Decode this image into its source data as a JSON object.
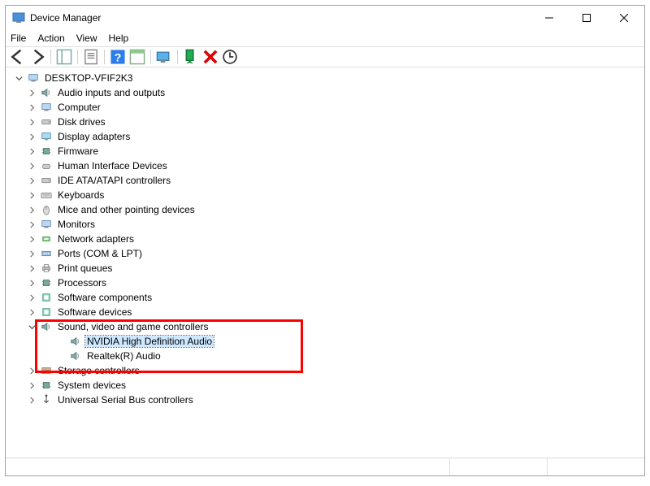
{
  "title": "Device Manager",
  "menu": {
    "file": "File",
    "action": "Action",
    "view": "View",
    "help": "Help"
  },
  "tree": {
    "root": "DESKTOP-VFIF2K3",
    "categories": [
      {
        "label": "Audio inputs and outputs"
      },
      {
        "label": "Computer"
      },
      {
        "label": "Disk drives"
      },
      {
        "label": "Display adapters"
      },
      {
        "label": "Firmware"
      },
      {
        "label": "Human Interface Devices"
      },
      {
        "label": "IDE ATA/ATAPI controllers"
      },
      {
        "label": "Keyboards"
      },
      {
        "label": "Mice and other pointing devices"
      },
      {
        "label": "Monitors"
      },
      {
        "label": "Network adapters"
      },
      {
        "label": "Ports (COM & LPT)"
      },
      {
        "label": "Print queues"
      },
      {
        "label": "Processors"
      },
      {
        "label": "Software components"
      },
      {
        "label": "Software devices"
      },
      {
        "label": "Sound, video and game controllers",
        "expanded": true,
        "children": [
          {
            "label": "NVIDIA High Definition Audio",
            "selected": true
          },
          {
            "label": "Realtek(R) Audio"
          }
        ]
      },
      {
        "label": "Storage controllers"
      },
      {
        "label": "System devices"
      },
      {
        "label": "Universal Serial Bus controllers"
      }
    ]
  }
}
